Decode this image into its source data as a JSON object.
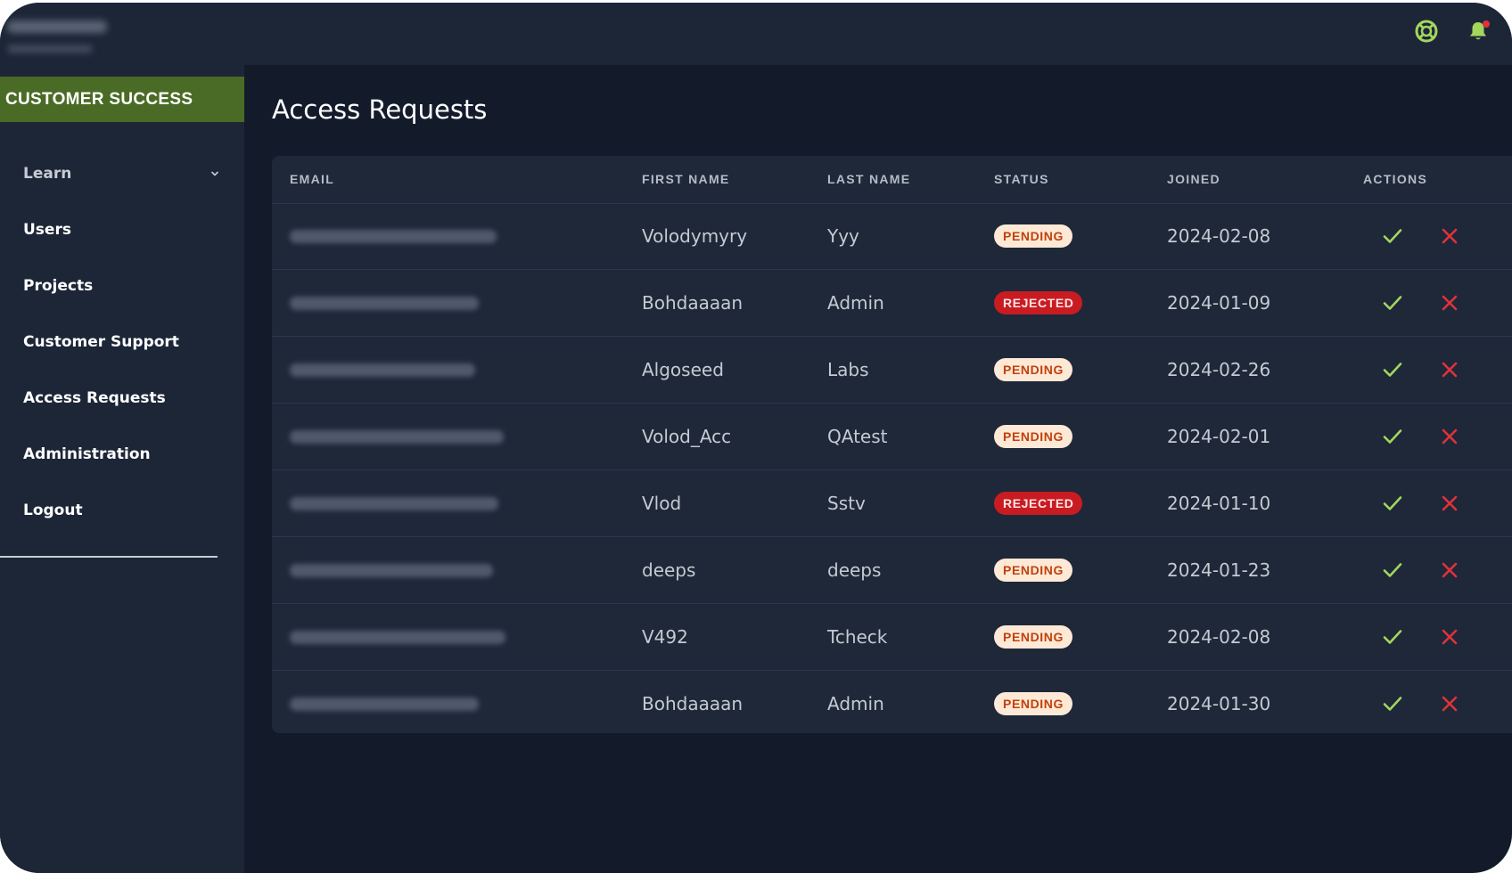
{
  "sidebar": {
    "section": "CUSTOMER SUCCESS",
    "items": [
      {
        "label": "Learn"
      },
      {
        "label": "Users"
      },
      {
        "label": "Projects"
      },
      {
        "label": "Customer Support"
      },
      {
        "label": "Access Requests"
      },
      {
        "label": "Administration"
      },
      {
        "label": "Logout"
      }
    ]
  },
  "topbar": {
    "icons": [
      "help-icon",
      "bell-icon"
    ]
  },
  "main": {
    "title": "Access Requests",
    "columns": [
      "EMAIL",
      "FIRST NAME",
      "LAST NAME",
      "STATUS",
      "JOINED",
      "ACTIONS"
    ],
    "rows": [
      {
        "first_name": "Volodymyry",
        "last_name": "Yyy",
        "status": "PENDING",
        "joined": "2024-02-08"
      },
      {
        "first_name": "Bohdaaaan",
        "last_name": "Admin",
        "status": "REJECTED",
        "joined": "2024-01-09"
      },
      {
        "first_name": "Algoseed",
        "last_name": "Labs",
        "status": "PENDING",
        "joined": "2024-02-26"
      },
      {
        "first_name": "Volod_Acc",
        "last_name": "QAtest",
        "status": "PENDING",
        "joined": "2024-02-01"
      },
      {
        "first_name": "Vlod",
        "last_name": "Sstv",
        "status": "REJECTED",
        "joined": "2024-01-10"
      },
      {
        "first_name": "deeps",
        "last_name": "deeps",
        "status": "PENDING",
        "joined": "2024-01-23"
      },
      {
        "first_name": "V492",
        "last_name": "Tcheck",
        "status": "PENDING",
        "joined": "2024-02-08"
      },
      {
        "first_name": "Bohdaaaan",
        "last_name": "Admin",
        "status": "PENDING",
        "joined": "2024-01-30"
      }
    ]
  },
  "colors": {
    "section_header": "#4a6b25",
    "pending_bg": "#fde9d6",
    "pending_text": "#c2410c",
    "rejected_bg": "#c91c22",
    "approve": "#a4d65e",
    "reject": "#e0323a"
  }
}
